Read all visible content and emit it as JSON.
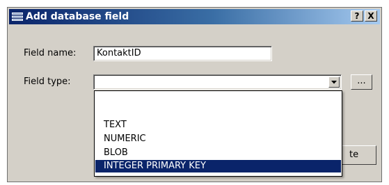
{
  "window": {
    "title": "Add database field",
    "help_button": "?",
    "close_button": "X"
  },
  "form": {
    "field_name_label": "Field name:",
    "field_name_value": "KontaktID",
    "field_type_label": "Field type:",
    "field_type_value": "",
    "more_button": "...",
    "create_button_partial": "te"
  },
  "dropdown": {
    "options": [
      "",
      "TEXT",
      "NUMERIC",
      "BLOB",
      "INTEGER PRIMARY KEY"
    ],
    "highlighted": "INTEGER PRIMARY KEY"
  },
  "colors": {
    "titlebar_start": "#0a246a",
    "titlebar_end": "#a6caf0",
    "dialog_face": "#d4d0c8",
    "selection": "#0a246a"
  },
  "icons": {
    "title_icon": "database-field-icon",
    "dropdown_arrow": "chevron-down-icon"
  }
}
